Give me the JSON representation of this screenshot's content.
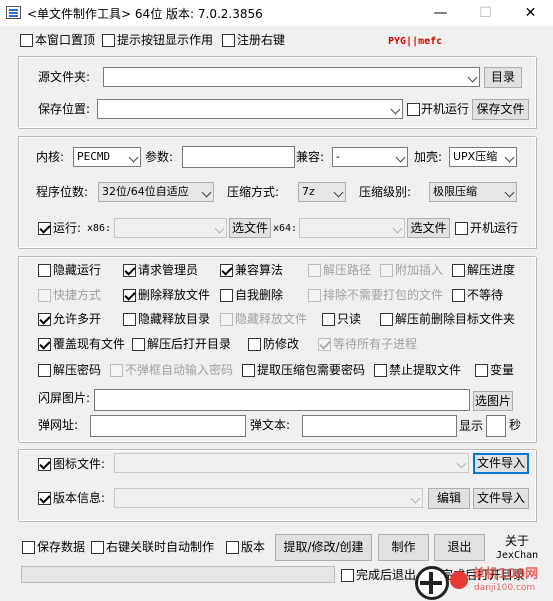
{
  "window": {
    "title": "<单文件制作工具> 64位 版本: 7.0.2.3856",
    "min": "—",
    "max": "☐",
    "close": "✕"
  },
  "topbar": {
    "stay_on_top": "本窗口置顶",
    "tooltip": "提示按钮显示作用",
    "register_menu": "注册右键",
    "credit": "PYG||mefc"
  },
  "source": {
    "src_label": "源文件夹:",
    "src_value": "",
    "browse": "目录",
    "save_label": "保存位置:",
    "save_value": "",
    "startup": "开机运行",
    "save_file": "保存文件"
  },
  "kernel": {
    "kernel_label": "内核:",
    "kernel_value": "PECMD",
    "args_label": "参数:",
    "args_value": "",
    "compat_label": "兼容:",
    "compat_value": "-",
    "shell_label": "加壳:",
    "shell_value": "UPX压缩",
    "bits_label": "程序位数:",
    "bits_value": "32位/64位自适应",
    "compress_label": "压缩方式:",
    "compress_value": "7z",
    "level_label": "压缩级别:",
    "level_value": "极限压缩",
    "run_label": "运行:",
    "x86_label": "x86:",
    "x86_value": "",
    "choose1": "选文件",
    "x64_label": "x64:",
    "x64_value": "",
    "choose2": "选文件",
    "startup2": "开机运行"
  },
  "options": {
    "r1": [
      "隐藏运行",
      "请求管理员",
      "兼容算法",
      "解压路径",
      "附加插入",
      "解压进度"
    ],
    "r2": [
      "快捷方式",
      "删除释放文件",
      "自我删除",
      "排除不需要打包的文件",
      "不等待"
    ],
    "r3": [
      "允许多开",
      "隐藏释放目录",
      "隐藏释放文件",
      "只读",
      "解压前删除目标文件夹"
    ],
    "r4": [
      "覆盖现有文件",
      "解压后打开目录",
      "防修改",
      "等待所有子进程"
    ],
    "r5": [
      "解压密码",
      "不弹框自动输入密码",
      "提取压缩包需要密码",
      "禁止提取文件",
      "变量"
    ]
  },
  "splash": {
    "image_label": "闪屏图片:",
    "image_value": "",
    "choose_image": "选图片",
    "url_label": "弹网址:",
    "url_value": "",
    "text_label": "弹文本:",
    "text_value": "",
    "show_label": "显示",
    "seconds_value": "",
    "sec_label": "秒"
  },
  "resources": {
    "icon_label": "图标文件:",
    "icon_value": "",
    "import1": "文件导入",
    "version_label": "版本信息:",
    "version_value": "",
    "edit": "编辑",
    "import2": "文件导入"
  },
  "bottom": {
    "save_data": "保存数据",
    "right_click_auto": "右键关联时自动制作",
    "version": "版本",
    "extract": "提取/修改/创建",
    "make": "制作",
    "quit": "退出",
    "about": "关于",
    "author": "JexChan",
    "after_exit": "完成后退出",
    "after_open": "完成后打开目录"
  },
  "watermark": {
    "text": "单机100网",
    "sub": "danji100.com"
  }
}
